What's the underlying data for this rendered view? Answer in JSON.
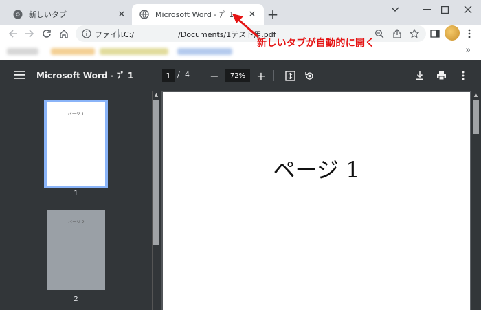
{
  "tabs": [
    {
      "title": "新しいタブ",
      "icon": "chrome-icon",
      "active": false
    },
    {
      "title": "Microsoft Word - ﾌﾟ 1",
      "icon": "globe-icon",
      "active": true
    }
  ],
  "new_tab_label": "+",
  "window_controls": {
    "dropdown": "⌄",
    "minimize": "—",
    "maximize": "☐",
    "close": "✕"
  },
  "omnibox": {
    "security_label": "ファイル",
    "url_prefix": "C:/",
    "url_path": "/Documents/1テスト用.pdf"
  },
  "annotation": {
    "text": "新しいタブが自動的に開く",
    "color": "#e51414"
  },
  "pdf_viewer": {
    "title": "Microsoft Word - ﾌﾟ 1",
    "current_page": "1",
    "page_separator": "/",
    "total_pages": "4",
    "zoom": "72%",
    "zoom_out": "−",
    "zoom_in": "+"
  },
  "thumbnails": [
    {
      "number": "1",
      "label": "ページ 1",
      "selected": true
    },
    {
      "number": "2",
      "label": "ページ 2",
      "selected": false
    }
  ],
  "page_content": {
    "heading": "ページ 1"
  },
  "colors": {
    "accent": "#8ab4f8",
    "toolbar_bg": "#323639",
    "tabstrip_bg": "#dee1e6"
  }
}
